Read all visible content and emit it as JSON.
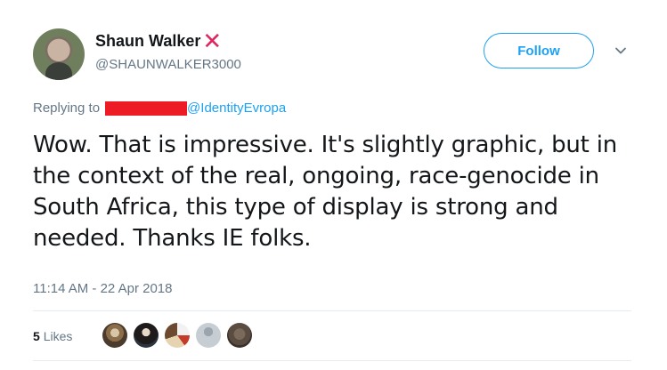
{
  "tweet": {
    "author": {
      "display_name": "Shaun Walker",
      "handle": "@SHAUNWALKER3000"
    },
    "follow_label": "Follow",
    "reply": {
      "prefix": "Replying to",
      "mention": "@IdentityEvropa"
    },
    "text": "Wow. That is impressive. It's slightly graphic, but in the context of the real, ongoing, race-genocide in South Africa, this type of display is strong and needed. Thanks IE folks.",
    "timestamp": "11:14 AM - 22 Apr 2018",
    "likes": {
      "count": "5",
      "label": "Likes"
    }
  },
  "colors": {
    "accent": "#1da1f2",
    "x_mark": "#e0245e",
    "redaction": "#ed1c24",
    "muted_text": "#657786"
  }
}
